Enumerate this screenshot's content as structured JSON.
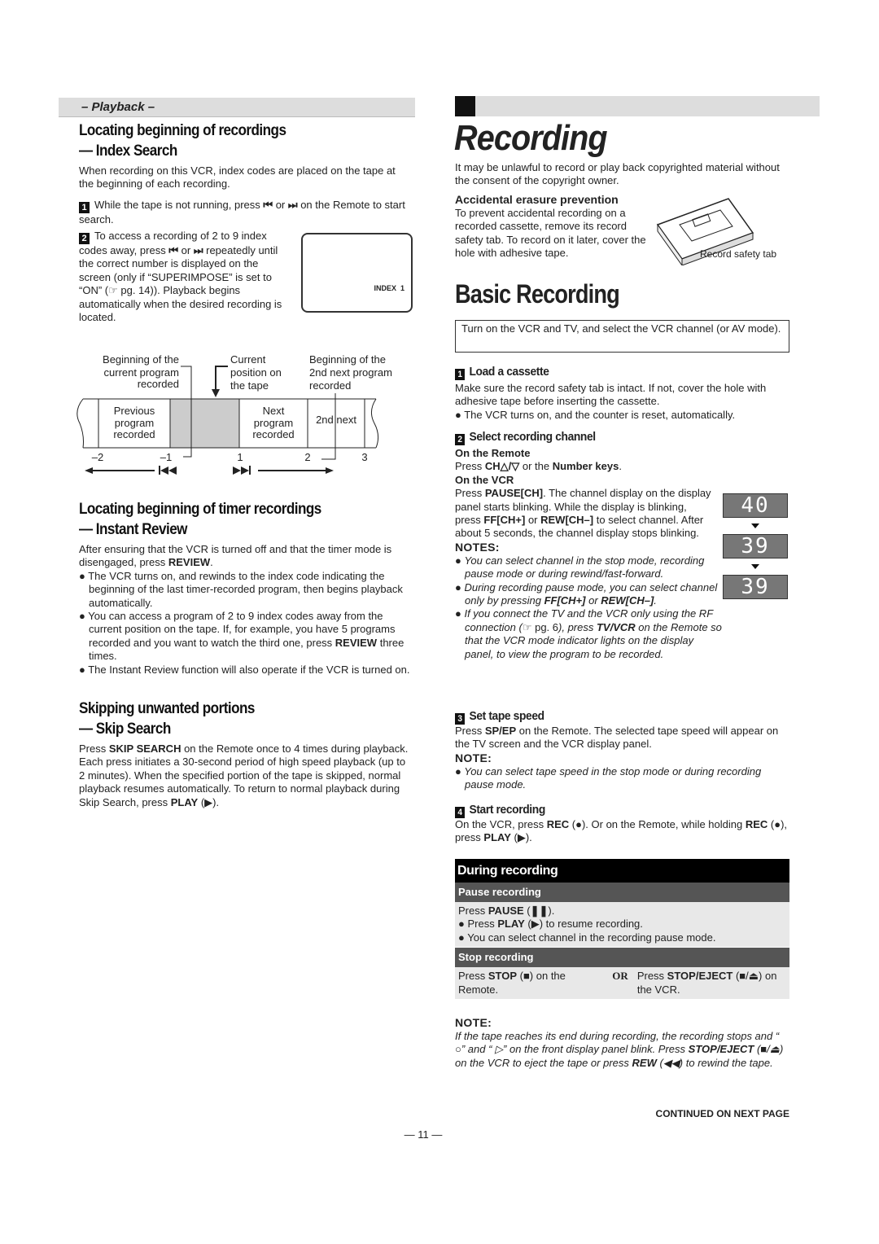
{
  "left": {
    "section_bar": "– Playback –",
    "index_search": {
      "heading": [
        "Locating beginning of recordings",
        "— Index Search"
      ],
      "intro": "When recording on this VCR, index codes are placed on the tape at the beginning of each recording.",
      "steps": [
        {
          "num": "1",
          "segs": [
            "While the tape is not running, press ",
            [
              "⏮",
              "b"
            ],
            " or ",
            [
              "⏭",
              "b"
            ],
            " on the Remote to start search."
          ]
        },
        {
          "num": "2",
          "segs": [
            "To access a recording of 2 to 9 index codes away, press ",
            [
              "⏮",
              "b"
            ],
            " or ",
            [
              "⏭",
              "b"
            ],
            " repeatedly until the correct number is displayed on the screen (only if “SUPERIMPOSE” is set to “ON” (☞ pg. 14)). Playback begins automatically when the desired recording is located."
          ]
        }
      ],
      "screen_text": "INDEX  1",
      "diagram": {
        "label_current_begin": [
          "Beginning of the",
          "current program",
          "recorded"
        ],
        "label_current_pos": [
          "Current",
          "position on",
          "the tape"
        ],
        "label_2nd_begin": [
          "Beginning of the",
          "2nd next program",
          "recorded"
        ],
        "seg_previous": [
          "Previous",
          "program",
          "recorded"
        ],
        "seg_next": [
          "Next",
          "program",
          "recorded"
        ],
        "seg_2nd": "2nd next",
        "ticks": [
          "–2",
          "–1",
          "1",
          "2",
          "3"
        ]
      }
    },
    "instant_review": {
      "heading": [
        "Locating beginning of timer recordings",
        "— Instant Review"
      ],
      "intro": [
        "After ensuring that the VCR is turned off and that the timer mode is disengaged, press ",
        [
          "REVIEW",
          "b"
        ],
        "."
      ],
      "bullets": [
        [
          "The VCR turns on, and rewinds to the index code indicating the beginning of the last timer-recorded program, then begins playback automatically."
        ],
        [
          "You can access a program of 2 to 9 index codes away from the current position on the tape. If, for example, you have 5 programs recorded and you want to watch the third one, press ",
          [
            "REVIEW",
            "b"
          ],
          " three times."
        ],
        [
          "The Instant Review function will also operate if the VCR is turned on."
        ]
      ]
    },
    "skip_search": {
      "heading": [
        "Skipping unwanted portions",
        "— Skip Search"
      ],
      "body": [
        "Press ",
        [
          "SKIP SEARCH",
          "b"
        ],
        " on the Remote once to 4 times during playback. Each press initiates a 30-second period of high speed playback (up to 2 minutes). When the specified portion of the tape is skipped, normal playback resumes automatically. To return to normal playback during Skip Search, press ",
        [
          "PLAY",
          "b"
        ],
        " (▶)."
      ]
    }
  },
  "right": {
    "title": "Recording",
    "intro": "It may be unlawful to record or play back copyrighted material without the consent of the copyright owner.",
    "erasure": {
      "heading": "Accidental erasure prevention",
      "body": "To prevent accidental recording on a recorded cassette, remove its record safety tab. To record on it later, cover the hole with adhesive tape.",
      "image_label": "Record safety tab"
    },
    "basic_title": "Basic Recording",
    "box_text": "Turn on the VCR and TV, and select the VCR channel (or AV mode).",
    "step1": {
      "num": "1",
      "heading": "Load a cassette",
      "body": "Make sure the record safety tab is intact. If not, cover the hole with adhesive tape before inserting the cassette.",
      "bullet": "The VCR turns on, and the counter is reset, automatically."
    },
    "step2": {
      "num": "2",
      "heading": "Select recording channel",
      "remote_label": "On the Remote",
      "remote_body": [
        "Press ",
        [
          "CH△/▽",
          "b"
        ],
        " or the ",
        [
          "Number keys",
          "b"
        ],
        "."
      ],
      "vcr_label": "On the VCR",
      "vcr_body": [
        "Press ",
        [
          "PAUSE[CH]",
          "b"
        ],
        ". The channel display on the display panel starts blinking. While the display is blinking, press ",
        [
          "FF[CH+]",
          "b"
        ],
        " or ",
        [
          "REW[CH–]",
          "b"
        ],
        " to select channel. After about 5 seconds, the channel display stops blinking."
      ],
      "displays": [
        "40",
        "39",
        "39"
      ],
      "notes_label": "NOTES:",
      "notes": [
        [
          [
            "You can select channel in the stop mode, recording pause mode or during rewind/fast-forward.",
            "i"
          ]
        ],
        [
          [
            "During recording pause mode, you can select channel only by pressing ",
            "i"
          ],
          [
            "FF[CH+]",
            "bi"
          ],
          [
            " or ",
            "i"
          ],
          [
            "REW[CH–]",
            "bi"
          ],
          [
            ".",
            "i"
          ]
        ],
        [
          [
            "If you connect the TV and the VCR only using the RF connection (",
            "i"
          ],
          "☞ pg. 6",
          [
            "), press ",
            "i"
          ],
          [
            "TV/VCR",
            "bi"
          ],
          [
            " on the Remote so that the VCR mode indicator lights on the display panel, to view the program to be recorded.",
            "i"
          ]
        ]
      ]
    },
    "step3": {
      "num": "3",
      "heading": "Set tape speed",
      "body": [
        "Press ",
        [
          "SP/EP",
          "b"
        ],
        " on the Remote. The selected tape speed will appear on the TV screen and the VCR display panel."
      ],
      "note_label": "NOTE:",
      "note": "You can select tape speed in the stop mode or during recording pause mode."
    },
    "step4": {
      "num": "4",
      "heading": "Start recording",
      "body": [
        "On the VCR, press ",
        [
          "REC",
          "b"
        ],
        " (●). Or on the Remote, while holding ",
        [
          "REC",
          "b"
        ],
        " (●), press ",
        [
          "PLAY",
          "b"
        ],
        " (▶)."
      ]
    },
    "during": {
      "title": "During recording",
      "pause_header": "Pause recording",
      "pause_body": [
        "Press ",
        [
          "PAUSE",
          "b"
        ],
        " (",
        [
          "❚❚",
          "b"
        ],
        ")."
      ],
      "pause_bullets": [
        [
          "Press ",
          [
            "PLAY",
            "b"
          ],
          " (▶) to resume recording."
        ],
        [
          "You can select channel in the recording pause mode."
        ]
      ],
      "stop_header": "Stop recording",
      "stop_left": [
        "Press ",
        [
          "STOP",
          "b"
        ],
        " (■) on the Remote."
      ],
      "or": "OR",
      "stop_right": [
        "Press ",
        [
          "STOP/EJECT",
          "b"
        ],
        " (■/⏏) on the VCR."
      ]
    },
    "note_label": "NOTE:",
    "note": [
      [
        "If the tape reaches its end during recording, the recording stops and “ ○” and “ ▷” on the front display panel blink. Press ",
        "i"
      ],
      [
        "STOP/EJECT",
        "bi"
      ],
      [
        " (■/⏏) on the VCR to eject the tape or press ",
        "i"
      ],
      [
        "REW",
        "bi"
      ],
      [
        " (◀◀) to rewind the tape.",
        "i"
      ]
    ],
    "continued": "CONTINUED ON NEXT PAGE"
  },
  "page_number": "— 11 —"
}
